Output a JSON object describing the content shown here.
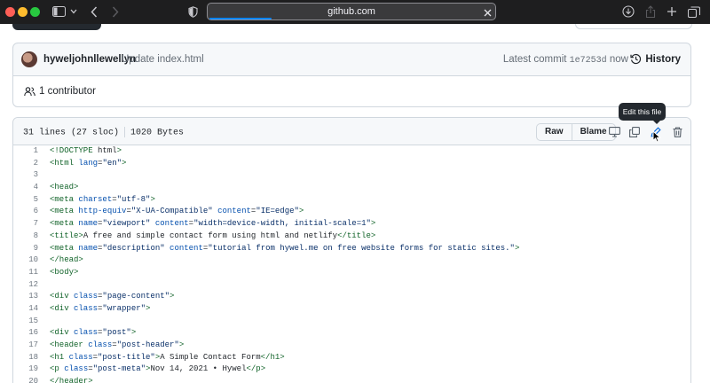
{
  "browser": {
    "url": "github.com",
    "colors": {
      "toolbar": "#1e1e1f",
      "progress": "#0a84ff"
    }
  },
  "commit": {
    "author": "hyweljohnllewellyn",
    "message": "Update index.html",
    "latest_label": "Latest commit",
    "sha": "1e7253d",
    "time": "now",
    "history_label": "History"
  },
  "contributors": {
    "label": "1 contributor"
  },
  "file": {
    "lines": "31 lines (27 sloc)",
    "size": "1020 Bytes",
    "raw_label": "Raw",
    "blame_label": "Blame",
    "tooltip": "Edit this file",
    "icons": [
      "desktop-icon",
      "copy-icon",
      "pencil-icon",
      "trash-icon"
    ]
  },
  "code_lines": [
    {
      "n": "1",
      "t": "<!DOCTYPE html>"
    },
    {
      "n": "2",
      "t": "<html lang=\"en\">"
    },
    {
      "n": "3",
      "t": ""
    },
    {
      "n": "4",
      "t": "<head>"
    },
    {
      "n": "5",
      "t": "<meta charset=\"utf-8\">"
    },
    {
      "n": "6",
      "t": "<meta http-equiv=\"X-UA-Compatible\" content=\"IE=edge\">"
    },
    {
      "n": "7",
      "t": "<meta name=\"viewport\" content=\"width=device-width, initial-scale=1\">"
    },
    {
      "n": "8",
      "t": "<title>A free and simple contact form using html and netlify</title>"
    },
    {
      "n": "9",
      "t": "<meta name=\"description\" content=\"tutorial from hywel.me on free website forms for static sites.\">"
    },
    {
      "n": "10",
      "t": "</head>"
    },
    {
      "n": "11",
      "t": "<body>"
    },
    {
      "n": "12",
      "t": ""
    },
    {
      "n": "13",
      "t": "<div class=\"page-content\">"
    },
    {
      "n": "14",
      "t": "<div class=\"wrapper\">"
    },
    {
      "n": "15",
      "t": ""
    },
    {
      "n": "16",
      "t": "<div class=\"post\">"
    },
    {
      "n": "17",
      "t": "<header class=\"post-header\">"
    },
    {
      "n": "18",
      "t": "<h1 class=\"post-title\">A Simple Contact Form</h1>"
    },
    {
      "n": "19",
      "t": "<p class=\"post-meta\">Nov 14, 2021 • Hywel</p>"
    },
    {
      "n": "20",
      "t": "</header>"
    }
  ]
}
